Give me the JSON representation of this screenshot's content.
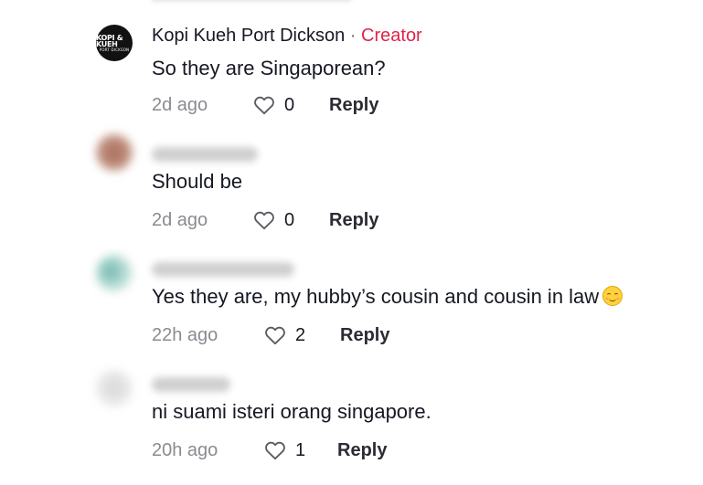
{
  "comments": [
    {
      "username": "Kopi Kueh Port Dickson",
      "separator": "·",
      "badge": "Creator",
      "avatar_logo_text": "KOPI & KUEH",
      "avatar_logo_subtext": "PORT DICKSON",
      "text": "So they are Singaporean?",
      "time": "2d ago",
      "likes": "0",
      "reply_label": "Reply"
    },
    {
      "username_hidden": true,
      "text": "Should be",
      "time": "2d ago",
      "likes": "0",
      "reply_label": "Reply"
    },
    {
      "username_hidden": true,
      "text": "Yes they are, my hubby’s cousin and cousin in law",
      "emoji": "smiling-face-emoji",
      "time": "22h ago",
      "likes": "2",
      "reply_label": "Reply"
    },
    {
      "username_hidden": true,
      "text": "ni suami isteri orang singapore.",
      "time": "20h ago",
      "likes": "1",
      "reply_label": "Reply"
    }
  ],
  "icons": {
    "like": "heart-outline-icon"
  },
  "colors": {
    "creator_badge": "#e0244d",
    "primary_text": "#161823",
    "secondary_text": "#8a8b91"
  }
}
